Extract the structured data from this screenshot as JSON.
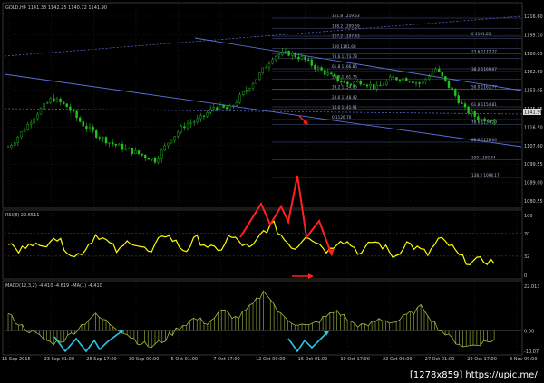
{
  "colors": {
    "background": "#000000",
    "candle": "#22c21e",
    "rsi_line": "#ffff00",
    "macd_line": "#a0c040",
    "macd_hist": "#7a8f30",
    "channel": "#5a6fd6",
    "fib": "#4a5a8a",
    "grid": "#2a2a2a",
    "annotation_red": "#ff2020",
    "annotation_cyan": "#29c7e8",
    "text": "#c8c8c8",
    "bid_badge_bg": "#dcdcdc"
  },
  "header": {
    "price": "GOLD,H4  1141.33 1142.25 1140.72 1141.90",
    "rsi": "RSI(8) 22.6511",
    "macd": "MACD(12,3,2) -4.410 -4.619  –MA(1) -4.410"
  },
  "price_axis": [
    "1216.60",
    "1195.10",
    "1180.05",
    "1162.60",
    "1153.05",
    "1125.05",
    "1116.50",
    "1107.60",
    "1099.55",
    "1089.00",
    "1080.55"
  ],
  "bid_badge": "1141.90",
  "rsi_axis": [
    "100",
    "70",
    "32",
    "0"
  ],
  "macd_axis": [
    "22.013",
    "0.00",
    "-10.07"
  ],
  "time_axis": [
    "16 Sep 2015",
    "23 Sep 01:00",
    "25 Sep 17:00",
    "30 Sep 09:00",
    "5 Oct 01:00",
    "7 Oct 17:00",
    "12 Oct 09:00",
    "15 Oct 01:00",
    "19 Oct 17:00",
    "22 Oct 09:00",
    "27 Oct 01:00",
    "29 Oct 17:00",
    "3 Nov 09:00"
  ],
  "fib_labels_left": [
    "161.8  1219.63",
    "138.2  1209.59",
    "127.2  1197.43",
    "100  1161.68",
    "78.6  1173.78",
    "61.8  1166.85",
    "50.0  1161.75",
    "38.2  1154.86",
    "23.6  1148.42",
    "14.6  1141.91",
    "0  1126.70"
  ],
  "fib_labels_right": [
    "0  1191.83",
    "23.6  1177.77",
    "38.2  1169.07",
    "50.0  1161.77",
    "61.8  1154.81",
    "78.6  1134.29",
    "88.6  1118.04",
    "100  1100.44",
    "138.2  1098.17"
  ],
  "watermark": "[1278x859] https://upic.me/",
  "chart_data": [
    {
      "type": "candlestick",
      "title": "GOLD,H4",
      "symbol": "GOLD",
      "timeframe": "H4",
      "ohlc_last": {
        "open": 1141.33,
        "high": 1142.25,
        "low": 1140.72,
        "close": 1141.9
      },
      "x": [
        "16 Sep 2015",
        "23 Sep 01:00",
        "25 Sep 17:00",
        "30 Sep 09:00",
        "5 Oct 01:00",
        "7 Oct 17:00",
        "12 Oct 09:00",
        "15 Oct 01:00",
        "19 Oct 17:00",
        "22 Oct 09:00",
        "27 Oct 01:00",
        "29 Oct 17:00",
        "3 Nov 09:00"
      ],
      "close_series": [
        1121,
        1133,
        1146,
        1156,
        1150,
        1138,
        1130,
        1124,
        1120,
        1116,
        1112,
        1127,
        1137,
        1141,
        1150,
        1148,
        1160,
        1172,
        1186,
        1188,
        1184,
        1177,
        1171,
        1166,
        1168,
        1163,
        1170,
        1170,
        1166,
        1177,
        1163,
        1148,
        1141,
        1142
      ],
      "ylim": [
        1080.55,
        1216.6
      ],
      "grid": true,
      "trendlines": [
        "descending channel upper",
        "descending channel lower",
        "dotted upper channel"
      ]
    },
    {
      "type": "line",
      "title": "RSI(8) 22.6511",
      "values": [
        55,
        38,
        60,
        42,
        68,
        50,
        30,
        45,
        70,
        55,
        38,
        60,
        48,
        35,
        72,
        58,
        40,
        62,
        50,
        38,
        65,
        55,
        42,
        72,
        85,
        60,
        45,
        70,
        55,
        40,
        62,
        52,
        35,
        58,
        48,
        30,
        55,
        45,
        35,
        60,
        50,
        28,
        22,
        25,
        22.65
      ],
      "ylim": [
        0,
        100
      ],
      "levels": [
        70,
        32
      ]
    },
    {
      "type": "line",
      "title": "MACD(12,3,2)",
      "series": [
        {
          "name": "MACD",
          "values": [
            8,
            2,
            -2,
            -6,
            -4,
            2,
            8,
            4,
            0,
            -5,
            -8,
            -4,
            2,
            6,
            4,
            10,
            6,
            12,
            20,
            8,
            4,
            2,
            6,
            10,
            4,
            2,
            6,
            4,
            8,
            12,
            2,
            -4,
            -8,
            -6,
            -4.41
          ]
        },
        {
          "name": "MA(1)",
          "values": [
            8,
            2,
            -2,
            -6,
            -4,
            2,
            8,
            4,
            0,
            -5,
            -8,
            -4,
            2,
            6,
            4,
            10,
            6,
            12,
            20,
            8,
            4,
            2,
            6,
            10,
            4,
            2,
            6,
            4,
            8,
            12,
            2,
            -4,
            -8,
            -6,
            -4.41
          ]
        }
      ],
      "ylim": [
        -10.07,
        22.013
      ],
      "zero_line": 0
    }
  ]
}
